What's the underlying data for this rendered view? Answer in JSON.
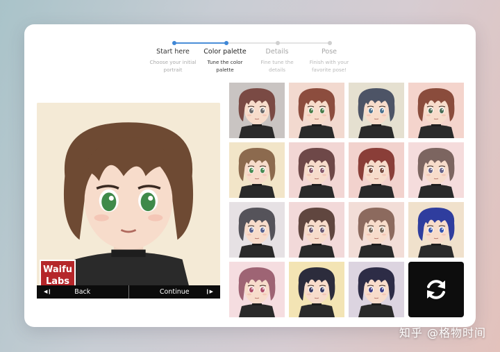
{
  "stepper": {
    "steps": [
      {
        "title": "Start here",
        "desc1": "Choose your initial",
        "desc2": "portrait",
        "state": "done"
      },
      {
        "title": "Color palette",
        "desc1": "Tune the color",
        "desc2": "palette",
        "state": "current"
      },
      {
        "title": "Details",
        "desc1": "Fine tune the",
        "desc2": "details",
        "state": "upcoming"
      },
      {
        "title": "Pose",
        "desc1": "Finish with your",
        "desc2": "favorite pose!",
        "state": "upcoming"
      }
    ],
    "accent_color": "#3f87d6"
  },
  "preview": {
    "logo_line1": "Waifu",
    "logo_line2": "Labs",
    "back_label": "Back",
    "continue_label": "Continue",
    "hair_color": "#6e4a33",
    "eye_color": "#3f8a4a",
    "background": "#f4ead6"
  },
  "variants": [
    {
      "bg": "#c9c4c2",
      "hair": "#7a4a44",
      "eye": "#6d6a6a"
    },
    {
      "bg": "#f2d9cf",
      "hair": "#8c4d3e",
      "eye": "#4c7d4a"
    },
    {
      "bg": "#e5e0d0",
      "hair": "#4d5466",
      "eye": "#4f7490"
    },
    {
      "bg": "#f4d4cc",
      "hair": "#8a4c3c",
      "eye": "#4d6e55"
    },
    {
      "bg": "#f2e5c8",
      "hair": "#8c6a4e",
      "eye": "#478a52"
    },
    {
      "bg": "#f2d6d4",
      "hair": "#6e4848",
      "eye": "#8a5a6a"
    },
    {
      "bg": "#f2d2cd",
      "hair": "#8a3e38",
      "eye": "#7a4d40"
    },
    {
      "bg": "#f5dcdc",
      "hair": "#7c6560",
      "eye": "#6a6488"
    },
    {
      "bg": "#e6e1e4",
      "hair": "#55535a",
      "eye": "#59618e"
    },
    {
      "bg": "#f2d9d9",
      "hair": "#60463f",
      "eye": "#6e5a72"
    },
    {
      "bg": "#f2ddd7",
      "hair": "#8c6a5e",
      "eye": "#7a6a5c"
    },
    {
      "bg": "#f0e1cc",
      "hair": "#2f3d9e",
      "eye": "#3855b0"
    },
    {
      "bg": "#f5dde0",
      "hair": "#9e6474",
      "eye": "#b0506a"
    },
    {
      "bg": "#f3e4b4",
      "hair": "#2c2c3c",
      "eye": "#3c3c64"
    },
    {
      "bg": "#dcd4e0",
      "hair": "#2d2c46",
      "eye": "#424088"
    }
  ],
  "refresh": {
    "icon": "refresh-icon"
  },
  "watermark": "知乎 @格物时间"
}
